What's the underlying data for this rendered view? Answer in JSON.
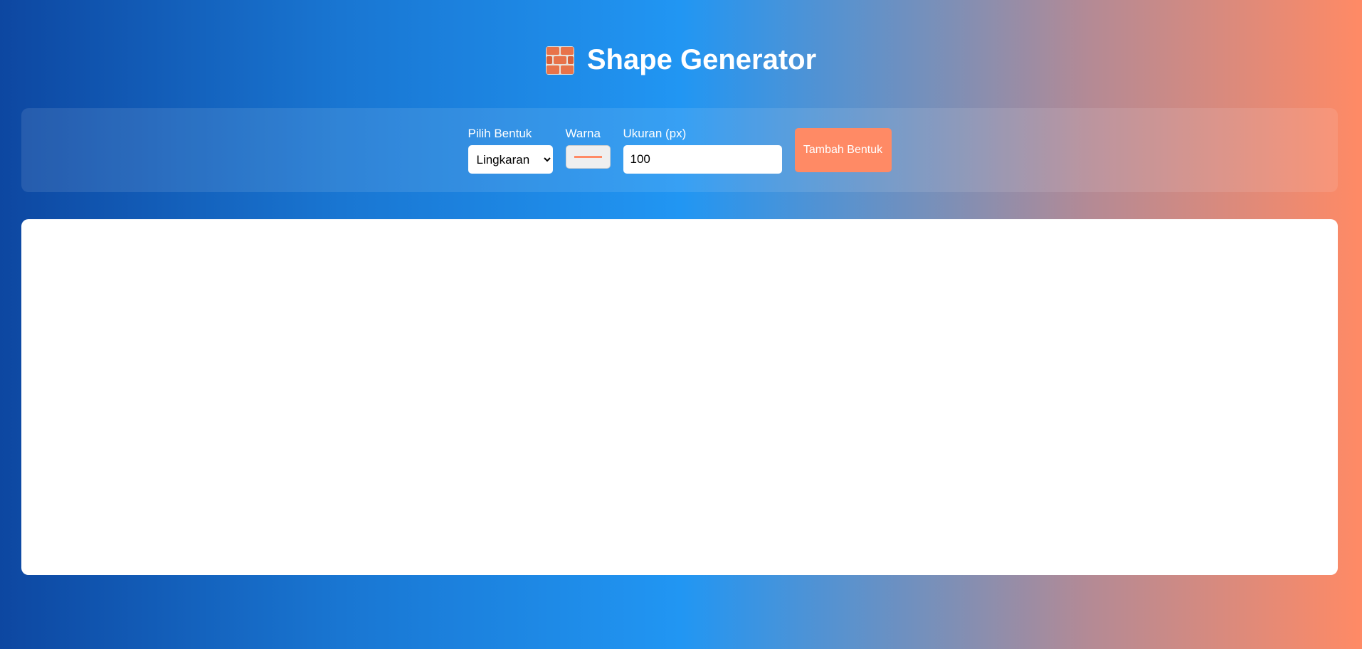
{
  "header": {
    "icon": "brick-icon",
    "title": "Shape Generator"
  },
  "controls": {
    "shape_label": "Pilih Bentuk",
    "shape_selected": "Lingkaran",
    "color_label": "Warna",
    "color_value": "#ff8a65",
    "size_label": "Ukuran (px)",
    "size_value": "100",
    "add_button_label": "Tambah Bentuk"
  },
  "colors": {
    "accent": "#ff8a65",
    "background_start": "#0d47a1",
    "background_mid": "#2196f3",
    "background_end": "#ff8a65"
  }
}
